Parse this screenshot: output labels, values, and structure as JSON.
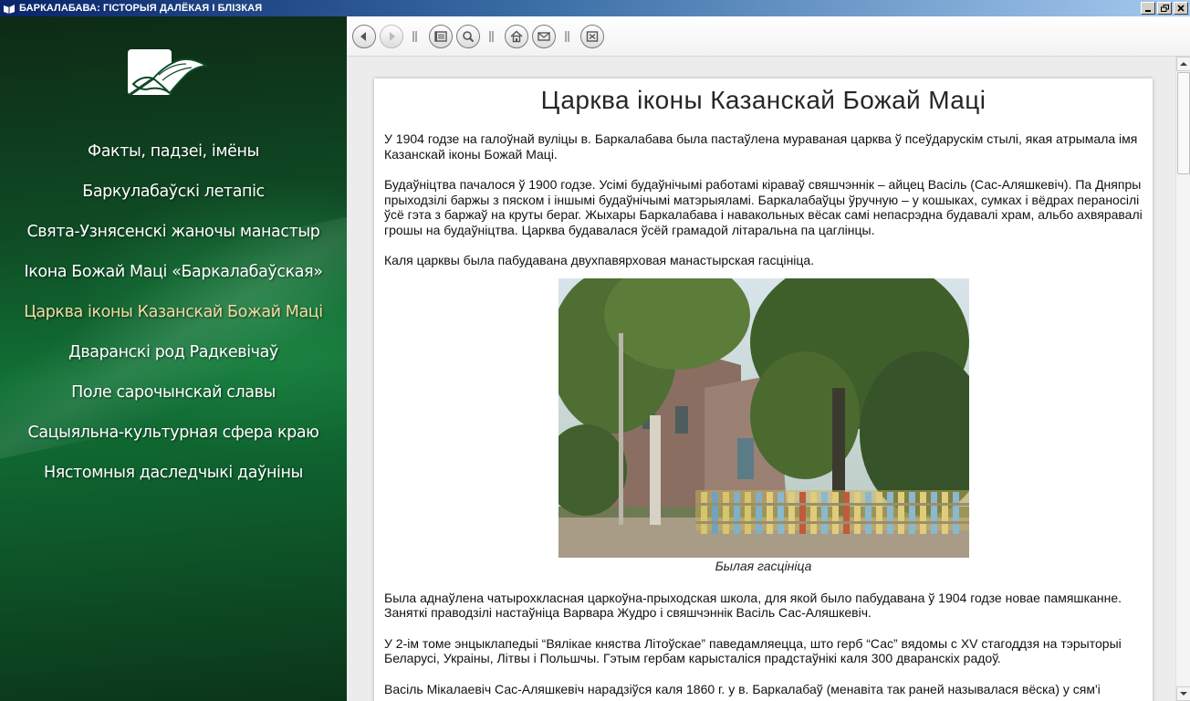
{
  "window": {
    "title": "БАРКАЛАБАВА: ГІСТОРЫЯ ДАЛЁКАЯ І БЛІЗКАЯ"
  },
  "sidebar": {
    "logo_icon": "open-book-logo",
    "items": [
      {
        "label": "Факты, падзеі, імёны"
      },
      {
        "label": "Баркулабаўскі летапіс"
      },
      {
        "label": "Свята-Узнясенскі жаночы манастыр"
      },
      {
        "label": "Ікона Божай Маці «Баркалабаўская»"
      },
      {
        "label": "Царква іконы Казанскай Божай Маці"
      },
      {
        "label": "Дваранскі род Радкевічаў"
      },
      {
        "label": "Поле сарочынскай славы"
      },
      {
        "label": "Сацыяльна-культурная сфера краю"
      },
      {
        "label": "Нястомныя даследчыкі даўніны"
      }
    ],
    "active_index": 4,
    "active_color": "#f3dca2"
  },
  "toolbar": {
    "buttons": [
      "back-icon",
      "forward-icon",
      "contents-icon",
      "search-icon",
      "home-icon",
      "mail-icon",
      "exit-icon"
    ]
  },
  "article": {
    "title": "Царква іконы Казанскай Божай Маці",
    "p1": "У 1904 годзе на галоўнай вуліцы в. Баркалабава была пастаўлена мураваная царква ў псеўдарускім стылі, якая атрымала імя Казанскай іконы Божай Маці.",
    "p2": "Будаўніцтва пачалося ў 1900 годзе. Усімі будаўнічымі работамі кіраваў свяшчэннік – айцец Васіль (Сас-Аляшкевіч). Па Дняпры прыходзілі баржы з пяском і іншымі будаўнічымі матэрыяламі. Баркалабаўцы ўручную – у кошыках, сумках і вёдрах пераносілі ўсё гэта з баржаў на круты бераг. Жыхары Баркалабава і навакольных вёсак самі непасрэдна будавалі храм, альбо ахвяравалі грошы на будаўніцтва. Царква будавалася ўсёй грамадой літаральна па цаглінцы.",
    "p3": "Каля царквы была пабудавана двухпавярховая манастырская гасцініца.",
    "photo_caption": "Былая гасцініца",
    "p4": "Была аднаўлена чатырохкласная царкоўна-прыходская школа, для якой было пабудавана ў 1904 годзе новае памяшканне. Заняткі праводзілі настаўніца Варвара Жудро і свяшчэннік Васіль Сас-Аляшкевіч.",
    "p5": "У 2-ім томе энцыклапедыі “Вялікае княства Літоўскае” паведамляецца, што герб “Сас” вядомы с XV стагоддзя на тэрыторыі Беларусі, Украіны, Літвы і Польшчы. Гэтым гербам карысталіся прадстаўнікі каля 300 дваранскіх радоў.",
    "p6": "Васіль Мікалаевіч Сас-Аляшкевіч нарадзіўся каля 1860 г. у в. Баркалабаў (менавіта так раней называлася вёска) у сям'і"
  }
}
